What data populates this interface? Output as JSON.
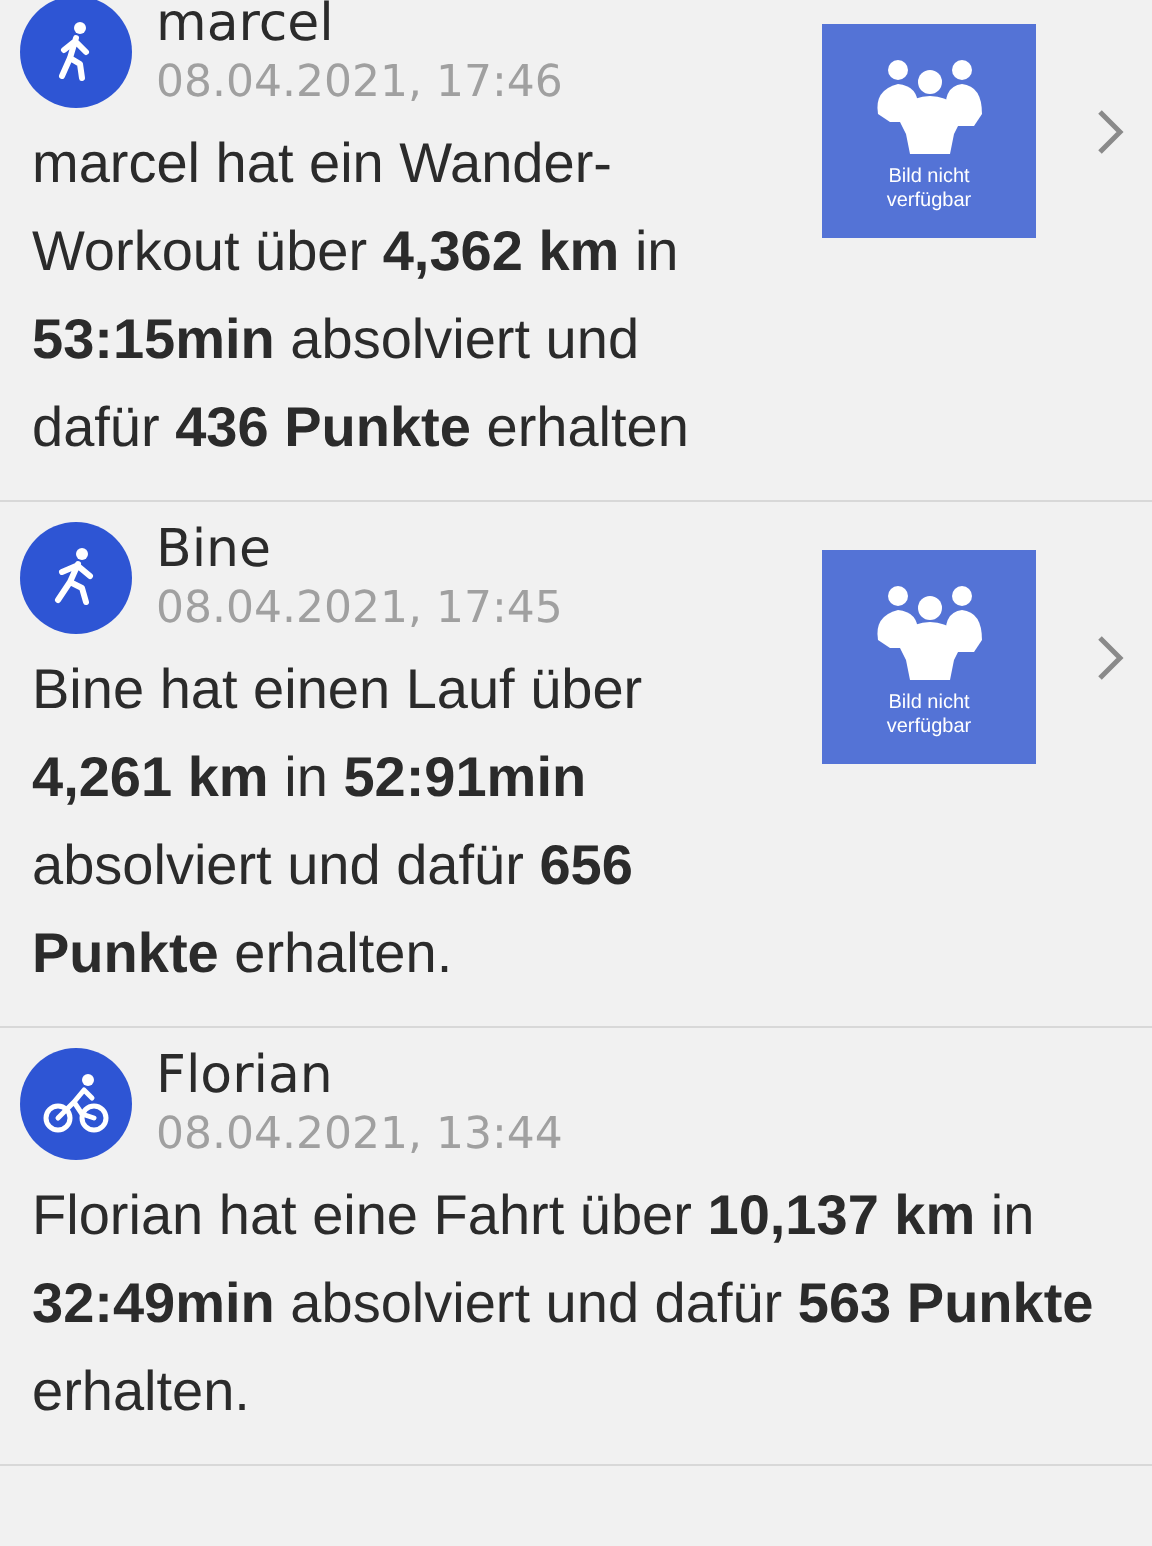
{
  "feed": [
    {
      "kind": "walk",
      "name": "marcel",
      "date": "08.04.2021, 17:46",
      "text": "marcel hat ein Wander-Workout über **4,362 km** in **53:15min** absolviert und dafür **436 Punkte** erhalten",
      "thumbnail": {
        "caption": "Bild nicht verfügbar"
      }
    },
    {
      "kind": "run",
      "name": "Bine",
      "date": "08.04.2021, 17:45",
      "text": "Bine hat einen Lauf über **4,261 km** in **52:91min** absolviert und dafür **656 Punkte** erhalten.",
      "thumbnail": {
        "caption": "Bild nicht verfügbar"
      }
    },
    {
      "kind": "bike",
      "name": "Florian",
      "date": "08.04.2021, 13:44",
      "text": "Florian hat eine Fahrt über **10,137 km** in **32:49min** absolviert und dafür **563 Punkte** erhalten."
    }
  ]
}
